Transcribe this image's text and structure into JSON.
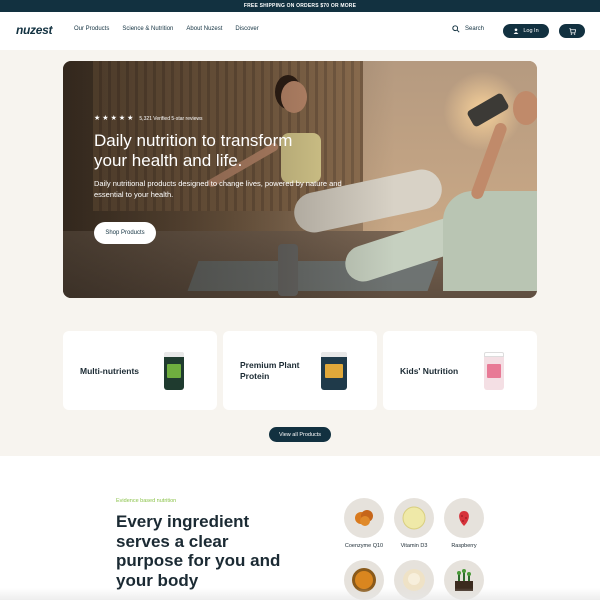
{
  "promo_bar": {
    "text": "FREE SHIPPING ON ORDERS $70 OR MORE"
  },
  "header": {
    "logo": "nuzest",
    "nav": [
      "Our Products",
      "Science & Nutrition",
      "About Nuzest",
      "Discover"
    ],
    "search_label": "Search",
    "login_label": "Log In",
    "cart_icon": "cart-icon"
  },
  "hero": {
    "rating_stars": 5,
    "reviews_text": "5,321 Verified 5-star reviews",
    "title": "Daily nutrition to transform your health and life.",
    "subtitle": "Daily nutritional products designed to change lives, powered by nature and essential to your health.",
    "cta_label": "Shop Products"
  },
  "categories": [
    {
      "label": "Multi-nutrients",
      "jar_color": "#1f3b2f",
      "label_color": "#6fae3f"
    },
    {
      "label": "Premium Plant Protein",
      "jar_color": "#1f3a4a",
      "label_color": "#e0a83a"
    },
    {
      "label": "Kids' Nutrition",
      "jar_color": "#f4dfe4",
      "label_color": "#e87a96"
    }
  ],
  "view_all_label": "View all Products",
  "evidence": {
    "eyebrow": "Evidence based nutrition",
    "title": "Every ingredient serves a clear purpose for you and your body",
    "ingredients": [
      {
        "label": "Coenzyme Q10",
        "color": "#d97a1e"
      },
      {
        "label": "Vitamin D3",
        "color": "#efe9a8"
      },
      {
        "label": "Raspberry",
        "color": "#d6323a"
      },
      {
        "label": "",
        "color": "#d9861f"
      },
      {
        "label": "",
        "color": "#efe2c6"
      },
      {
        "label": "",
        "color": "#2e6b2e"
      }
    ]
  },
  "colors": {
    "brand": "#123140",
    "accent": "#8bc34a",
    "background": "#f7f4ef"
  }
}
